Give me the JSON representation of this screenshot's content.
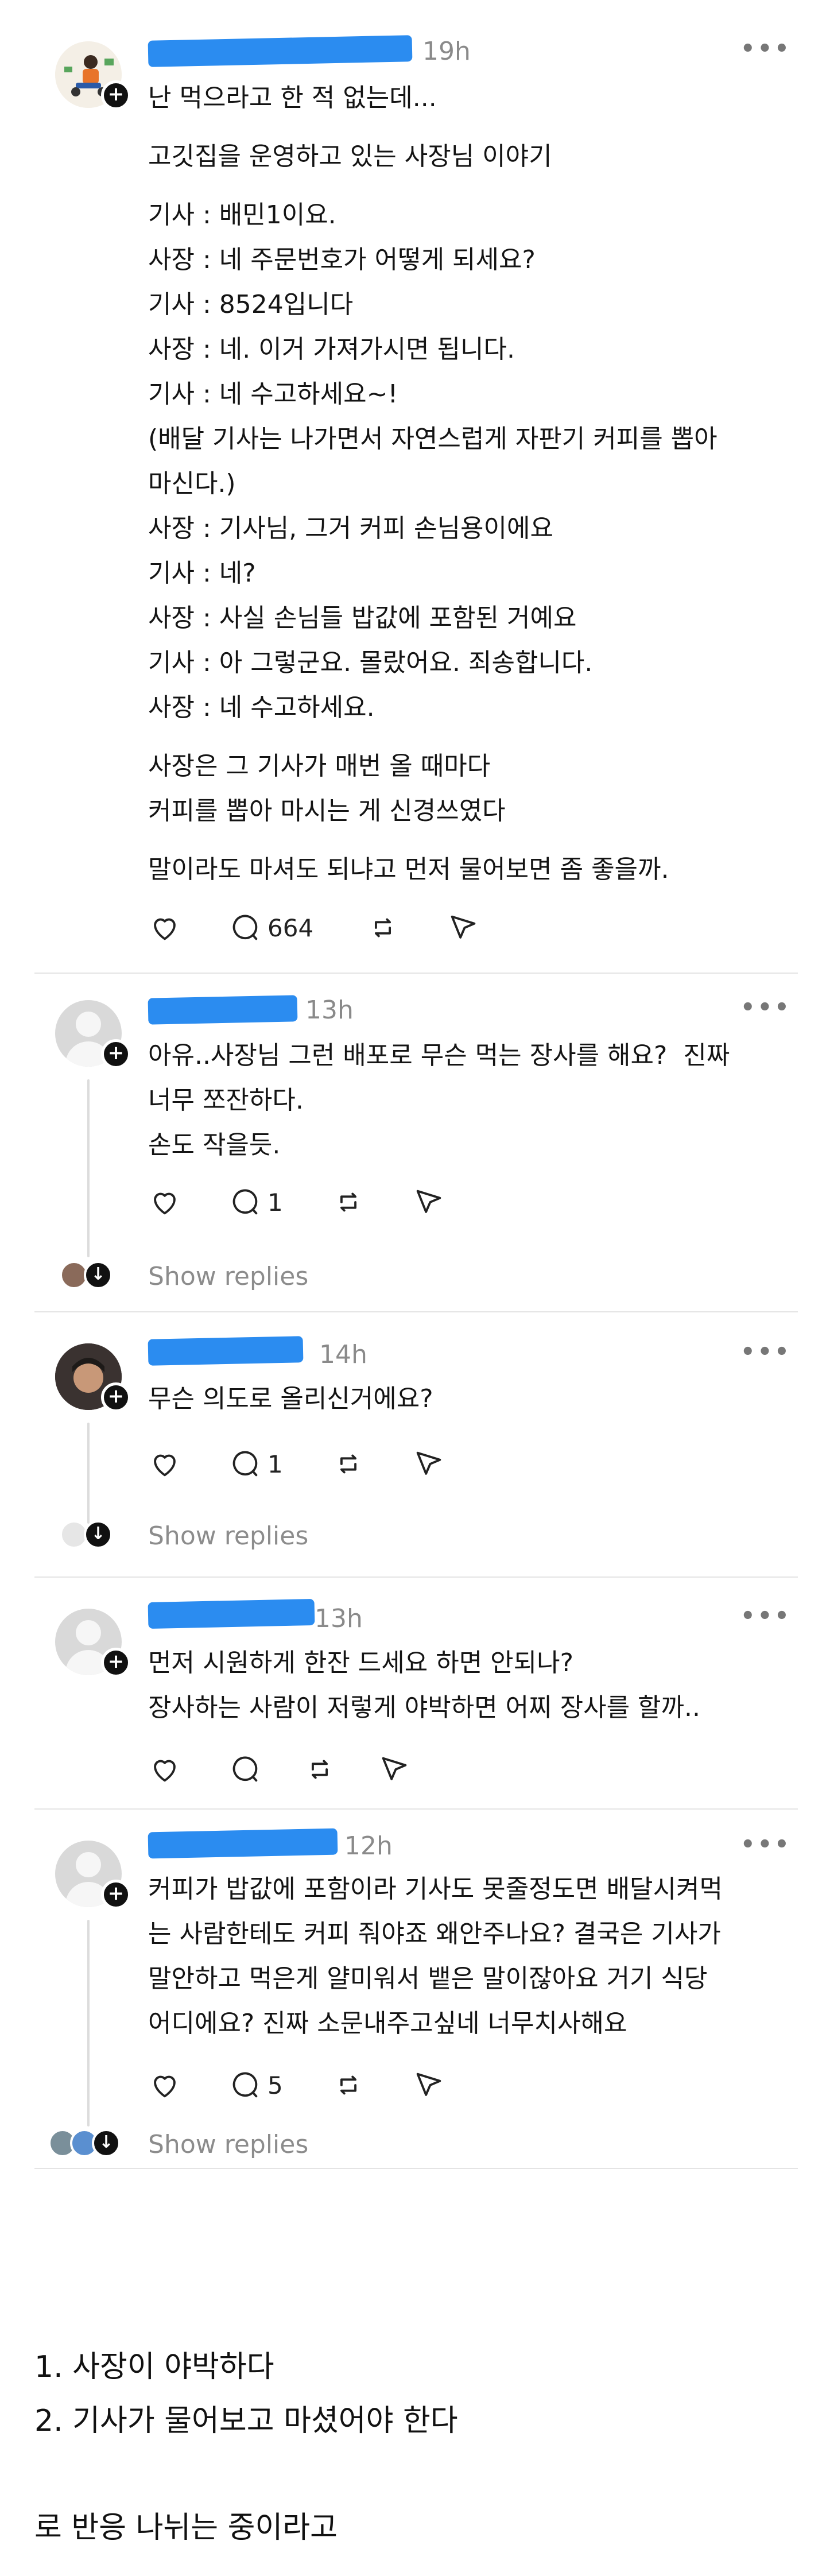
{
  "post": {
    "time": "19h",
    "lines": [
      "난 먹으라고 한 적 없는데...",
      "고깃집을 운영하고 있는 사장님 이야기",
      "기사 : 배민1이요.",
      "사장 : 네 주문번호가 어떻게 되세요?",
      "기사 : 8524입니다",
      "사장 : 네. 이거 가져가시면 됩니다.",
      "기사 : 네 수고하세요~!",
      "(배달 기사는 나가면서 자연스럽게 자판기 커피를 뽑아",
      "마신다.)",
      "사장 : 기사님, 그거 커피 손님용이에요",
      "기사 : 네?",
      "사장 : 사실 손님들 밥값에 포함된 거예요",
      "기사 : 아 그렇군요. 몰랐어요. 죄송합니다.",
      "사장 : 네 수고하세요.",
      "사장은 그 기사가 매번 올 때마다",
      "커피를 뽑아 마시는 게 신경쓰였다",
      "말이라도 마셔도 되냐고 먼저 물어보면 좀 좋을까."
    ],
    "reply_count": "664"
  },
  "replies": [
    {
      "time": "13h",
      "lines": [
        "아유..사장님 그런 배포로 무슨 먹는 장사를 해요?  진짜",
        "너무 쪼잔하다.",
        "손도 작을듯."
      ],
      "reply_count": "1",
      "show_replies": "Show replies"
    },
    {
      "time": "14h",
      "lines": [
        "무슨 의도로 올리신거에요?"
      ],
      "reply_count": "1",
      "show_replies": "Show replies"
    },
    {
      "time": "13h",
      "lines": [
        "먼저 시원하게 한잔 드세요 하면 안되나?",
        "장사하는 사람이 저렇게 야박하면 어찌 장사를 할까.."
      ],
      "reply_count": ""
    },
    {
      "time": "12h",
      "lines": [
        "커피가 밥값에 포함이라 기사도 못줄정도면 배달시켜먹",
        "는 사람한테도 커피 줘야죠 왜안주나요? 결국은 기사가",
        "말안하고 먹은게 얄미워서 뱉은 말이잖아요 거기 식당",
        "어디에요? 진짜 소문내주고싶네 너무치사해요"
      ],
      "reply_count": "5",
      "show_replies": "Show replies"
    }
  ],
  "footer": {
    "item1": "1. 사장이 야박하다",
    "item2": "2. 기사가 물어보고 마셨어야 한다",
    "conclusion": "로 반응 나뉘는 중이라고"
  },
  "icons": {
    "like": "heart-icon",
    "comment": "comment-icon",
    "repost": "repost-icon",
    "share": "send-icon",
    "more": "more-icon",
    "follow": "plus-icon"
  },
  "colors": {
    "redaction": "#2b8cf0",
    "text": "#141414",
    "muted": "#8a8a8a",
    "divider": "#e4e4e4"
  }
}
